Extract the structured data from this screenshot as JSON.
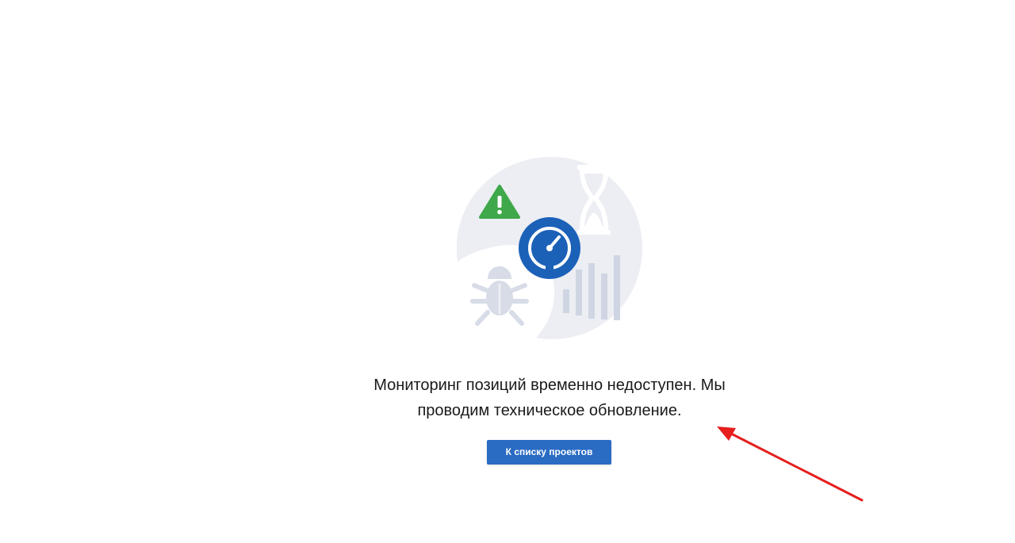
{
  "message": {
    "line1": "Мониторинг позиций временно недоступен. Мы",
    "line2": "проводим техническое обновление."
  },
  "button": {
    "label": "К списку проектов"
  },
  "illustration": {
    "icons": [
      "warning-icon",
      "speedometer-icon",
      "hourglass-icon",
      "bug-icon",
      "bar-chart-icon"
    ]
  },
  "colors": {
    "accent": "#2a6bc4",
    "warning": "#3fa84a",
    "gauge": "#1c61b8",
    "illustration_bg": "#eceef3",
    "annotation_arrow": "#e61e1e"
  }
}
